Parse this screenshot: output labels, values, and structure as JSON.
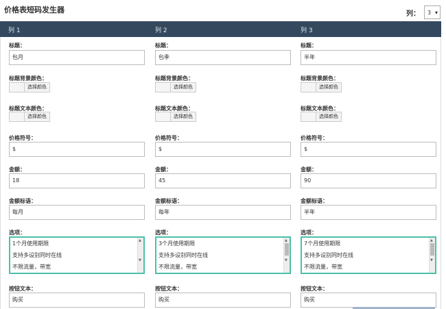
{
  "page": {
    "title": "价格表短码发生器"
  },
  "columns_control": {
    "label": "列：",
    "value": "3",
    "arrow": "▾"
  },
  "header": {
    "cols": [
      "列 1",
      "列 2",
      "列 3"
    ]
  },
  "labels": {
    "title": "标题：",
    "title_bg": "标题背景颜色：",
    "title_text_color": "标题文本颜色：",
    "price_symbol": "价格符号：",
    "amount": "金额：",
    "amount_title": "金额标语：",
    "options": "选项：",
    "button_text": "按钮文本：",
    "choose_color": "选择颜色"
  },
  "cols": [
    {
      "title": "包月",
      "symbol": "$",
      "amount": "18",
      "amount_title": "每月",
      "options": [
        "1个月使用期限",
        "支持多设别同时在线",
        "不限流量，带宽"
      ],
      "button": "购买"
    },
    {
      "title": "包季",
      "symbol": "$",
      "amount": "45",
      "amount_title": "每年",
      "options": [
        "3个月使用期限",
        "支持多设别同时在线",
        "不限流量，带宽"
      ],
      "button": "购买"
    },
    {
      "title": "半年",
      "symbol": "$",
      "amount": "90",
      "amount_title": "半年",
      "options": [
        "7个月使用期限",
        "支持多设别同时在线",
        "不限流量，带宽"
      ],
      "button": "购买"
    }
  ],
  "colors": {
    "header_bg": "#34495e",
    "focus_border": "#4bc0a7"
  },
  "icons": {
    "scroll_up": "▲",
    "scroll_down": "▼"
  }
}
